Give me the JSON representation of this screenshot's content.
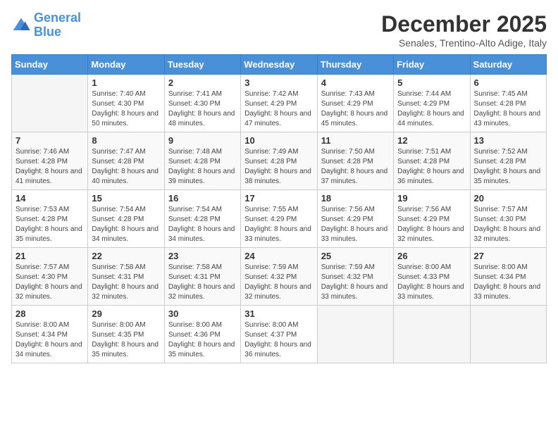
{
  "logo": {
    "line1": "General",
    "line2": "Blue"
  },
  "title": "December 2025",
  "subtitle": "Senales, Trentino-Alto Adige, Italy",
  "days_header": [
    "Sunday",
    "Monday",
    "Tuesday",
    "Wednesday",
    "Thursday",
    "Friday",
    "Saturday"
  ],
  "weeks": [
    [
      {
        "num": "",
        "sunrise": "",
        "sunset": "",
        "daylight": ""
      },
      {
        "num": "1",
        "sunrise": "Sunrise: 7:40 AM",
        "sunset": "Sunset: 4:30 PM",
        "daylight": "Daylight: 8 hours and 50 minutes."
      },
      {
        "num": "2",
        "sunrise": "Sunrise: 7:41 AM",
        "sunset": "Sunset: 4:30 PM",
        "daylight": "Daylight: 8 hours and 48 minutes."
      },
      {
        "num": "3",
        "sunrise": "Sunrise: 7:42 AM",
        "sunset": "Sunset: 4:29 PM",
        "daylight": "Daylight: 8 hours and 47 minutes."
      },
      {
        "num": "4",
        "sunrise": "Sunrise: 7:43 AM",
        "sunset": "Sunset: 4:29 PM",
        "daylight": "Daylight: 8 hours and 45 minutes."
      },
      {
        "num": "5",
        "sunrise": "Sunrise: 7:44 AM",
        "sunset": "Sunset: 4:29 PM",
        "daylight": "Daylight: 8 hours and 44 minutes."
      },
      {
        "num": "6",
        "sunrise": "Sunrise: 7:45 AM",
        "sunset": "Sunset: 4:28 PM",
        "daylight": "Daylight: 8 hours and 43 minutes."
      }
    ],
    [
      {
        "num": "7",
        "sunrise": "Sunrise: 7:46 AM",
        "sunset": "Sunset: 4:28 PM",
        "daylight": "Daylight: 8 hours and 41 minutes."
      },
      {
        "num": "8",
        "sunrise": "Sunrise: 7:47 AM",
        "sunset": "Sunset: 4:28 PM",
        "daylight": "Daylight: 8 hours and 40 minutes."
      },
      {
        "num": "9",
        "sunrise": "Sunrise: 7:48 AM",
        "sunset": "Sunset: 4:28 PM",
        "daylight": "Daylight: 8 hours and 39 minutes."
      },
      {
        "num": "10",
        "sunrise": "Sunrise: 7:49 AM",
        "sunset": "Sunset: 4:28 PM",
        "daylight": "Daylight: 8 hours and 38 minutes."
      },
      {
        "num": "11",
        "sunrise": "Sunrise: 7:50 AM",
        "sunset": "Sunset: 4:28 PM",
        "daylight": "Daylight: 8 hours and 37 minutes."
      },
      {
        "num": "12",
        "sunrise": "Sunrise: 7:51 AM",
        "sunset": "Sunset: 4:28 PM",
        "daylight": "Daylight: 8 hours and 36 minutes."
      },
      {
        "num": "13",
        "sunrise": "Sunrise: 7:52 AM",
        "sunset": "Sunset: 4:28 PM",
        "daylight": "Daylight: 8 hours and 35 minutes."
      }
    ],
    [
      {
        "num": "14",
        "sunrise": "Sunrise: 7:53 AM",
        "sunset": "Sunset: 4:28 PM",
        "daylight": "Daylight: 8 hours and 35 minutes."
      },
      {
        "num": "15",
        "sunrise": "Sunrise: 7:54 AM",
        "sunset": "Sunset: 4:28 PM",
        "daylight": "Daylight: 8 hours and 34 minutes."
      },
      {
        "num": "16",
        "sunrise": "Sunrise: 7:54 AM",
        "sunset": "Sunset: 4:28 PM",
        "daylight": "Daylight: 8 hours and 34 minutes."
      },
      {
        "num": "17",
        "sunrise": "Sunrise: 7:55 AM",
        "sunset": "Sunset: 4:29 PM",
        "daylight": "Daylight: 8 hours and 33 minutes."
      },
      {
        "num": "18",
        "sunrise": "Sunrise: 7:56 AM",
        "sunset": "Sunset: 4:29 PM",
        "daylight": "Daylight: 8 hours and 33 minutes."
      },
      {
        "num": "19",
        "sunrise": "Sunrise: 7:56 AM",
        "sunset": "Sunset: 4:29 PM",
        "daylight": "Daylight: 8 hours and 32 minutes."
      },
      {
        "num": "20",
        "sunrise": "Sunrise: 7:57 AM",
        "sunset": "Sunset: 4:30 PM",
        "daylight": "Daylight: 8 hours and 32 minutes."
      }
    ],
    [
      {
        "num": "21",
        "sunrise": "Sunrise: 7:57 AM",
        "sunset": "Sunset: 4:30 PM",
        "daylight": "Daylight: 8 hours and 32 minutes."
      },
      {
        "num": "22",
        "sunrise": "Sunrise: 7:58 AM",
        "sunset": "Sunset: 4:31 PM",
        "daylight": "Daylight: 8 hours and 32 minutes."
      },
      {
        "num": "23",
        "sunrise": "Sunrise: 7:58 AM",
        "sunset": "Sunset: 4:31 PM",
        "daylight": "Daylight: 8 hours and 32 minutes."
      },
      {
        "num": "24",
        "sunrise": "Sunrise: 7:59 AM",
        "sunset": "Sunset: 4:32 PM",
        "daylight": "Daylight: 8 hours and 32 minutes."
      },
      {
        "num": "25",
        "sunrise": "Sunrise: 7:59 AM",
        "sunset": "Sunset: 4:32 PM",
        "daylight": "Daylight: 8 hours and 33 minutes."
      },
      {
        "num": "26",
        "sunrise": "Sunrise: 8:00 AM",
        "sunset": "Sunset: 4:33 PM",
        "daylight": "Daylight: 8 hours and 33 minutes."
      },
      {
        "num": "27",
        "sunrise": "Sunrise: 8:00 AM",
        "sunset": "Sunset: 4:34 PM",
        "daylight": "Daylight: 8 hours and 33 minutes."
      }
    ],
    [
      {
        "num": "28",
        "sunrise": "Sunrise: 8:00 AM",
        "sunset": "Sunset: 4:34 PM",
        "daylight": "Daylight: 8 hours and 34 minutes."
      },
      {
        "num": "29",
        "sunrise": "Sunrise: 8:00 AM",
        "sunset": "Sunset: 4:35 PM",
        "daylight": "Daylight: 8 hours and 35 minutes."
      },
      {
        "num": "30",
        "sunrise": "Sunrise: 8:00 AM",
        "sunset": "Sunset: 4:36 PM",
        "daylight": "Daylight: 8 hours and 35 minutes."
      },
      {
        "num": "31",
        "sunrise": "Sunrise: 8:00 AM",
        "sunset": "Sunset: 4:37 PM",
        "daylight": "Daylight: 8 hours and 36 minutes."
      },
      {
        "num": "",
        "sunrise": "",
        "sunset": "",
        "daylight": ""
      },
      {
        "num": "",
        "sunrise": "",
        "sunset": "",
        "daylight": ""
      },
      {
        "num": "",
        "sunrise": "",
        "sunset": "",
        "daylight": ""
      }
    ]
  ]
}
